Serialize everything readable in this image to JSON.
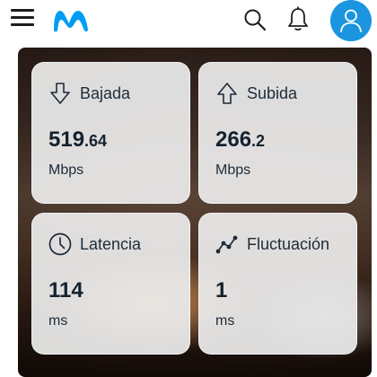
{
  "header": {
    "menu_icon": "hamburger-menu-icon",
    "logo_icon": "movistar-m-logo",
    "search_icon": "search-icon",
    "notifications_icon": "bell-icon",
    "account_icon": "user-icon",
    "brand_color": "#019DF4",
    "avatar_color": "#1B95E0"
  },
  "speedtest": {
    "download": {
      "label": "Bajada",
      "value_int": "519",
      "value_dec": ".64",
      "unit": "Mbps",
      "icon": "download-arrow-icon"
    },
    "upload": {
      "label": "Subida",
      "value_int": "266",
      "value_dec": ".2",
      "unit": "Mbps",
      "icon": "upload-arrow-icon"
    },
    "latency": {
      "label": "Latencia",
      "value_int": "114",
      "value_dec": "",
      "unit": "ms",
      "icon": "clock-icon"
    },
    "jitter": {
      "label": "Fluctuación",
      "value_int": "1",
      "value_dec": "",
      "unit": "ms",
      "icon": "line-chart-icon"
    }
  }
}
